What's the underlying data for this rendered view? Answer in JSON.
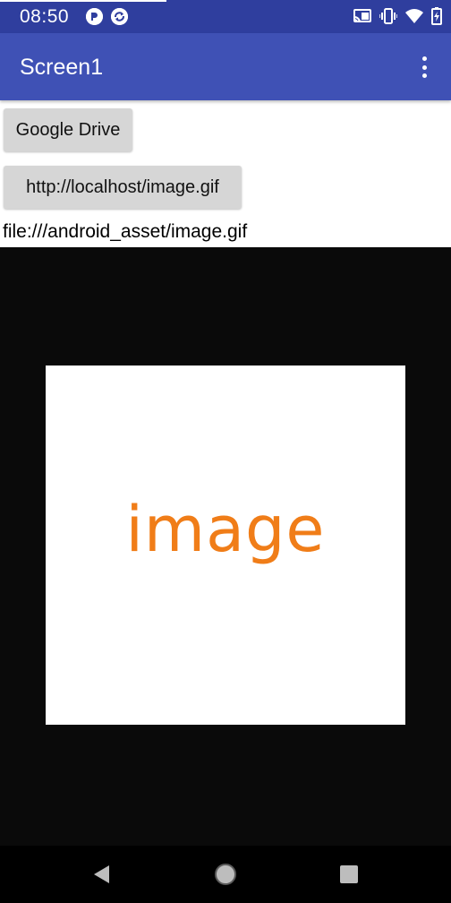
{
  "status_bar": {
    "time": "08:50",
    "icons": [
      "notification-icon",
      "sync-icon",
      "cast-icon",
      "vibrate-icon",
      "wifi-icon",
      "battery-icon"
    ]
  },
  "app_bar": {
    "title": "Screen1",
    "menu_icon": "more-vert-icon"
  },
  "buttons": {
    "google_drive": "Google Drive",
    "localhost": "http://localhost/image.gif"
  },
  "path_label": "file:///android_asset/image.gif",
  "image": {
    "word": "image",
    "word_color": "#f07d18"
  },
  "nav_bar": {
    "icons": [
      "back-icon",
      "home-icon",
      "recents-icon"
    ]
  },
  "colors": {
    "status_bar": "#2f3e9e",
    "app_bar": "#3f51b5",
    "button": "#d6d6d6",
    "image_background": "#0a0a0a"
  }
}
